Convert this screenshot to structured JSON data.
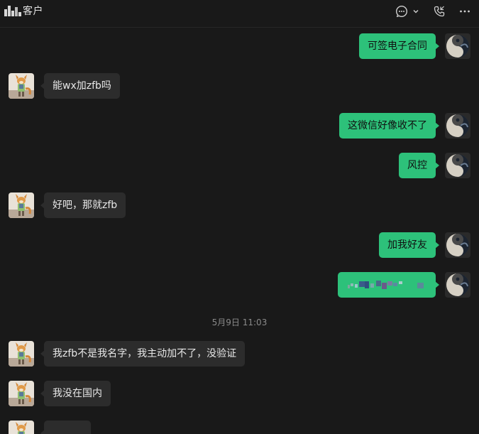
{
  "header": {
    "title": "客户",
    "icons": [
      "chat-bubble-icon",
      "chevron-down-icon",
      "phone-call-icon",
      "more-icon"
    ]
  },
  "colors": {
    "outgoing_bubble": "#2dc17a",
    "incoming_bubble": "#2c2c2c",
    "background": "#191919"
  },
  "messages": [
    {
      "side": "out",
      "text": "可签电子合同"
    },
    {
      "side": "in",
      "text": "能wx加zfb吗"
    },
    {
      "side": "out",
      "text": "这微信好像收不了"
    },
    {
      "side": "out",
      "text": "风控"
    },
    {
      "side": "in",
      "text": "好吧，那就zfb"
    },
    {
      "side": "out",
      "text": "加我好友"
    },
    {
      "side": "out",
      "text": ""
    },
    {
      "side": "in",
      "text": "我zfb不是我名字，我主动加不了，没验证"
    },
    {
      "side": "in",
      "text": "我没在国内"
    },
    {
      "side": "in",
      "text": ""
    }
  ],
  "timestamp": "5月9日 11:03"
}
